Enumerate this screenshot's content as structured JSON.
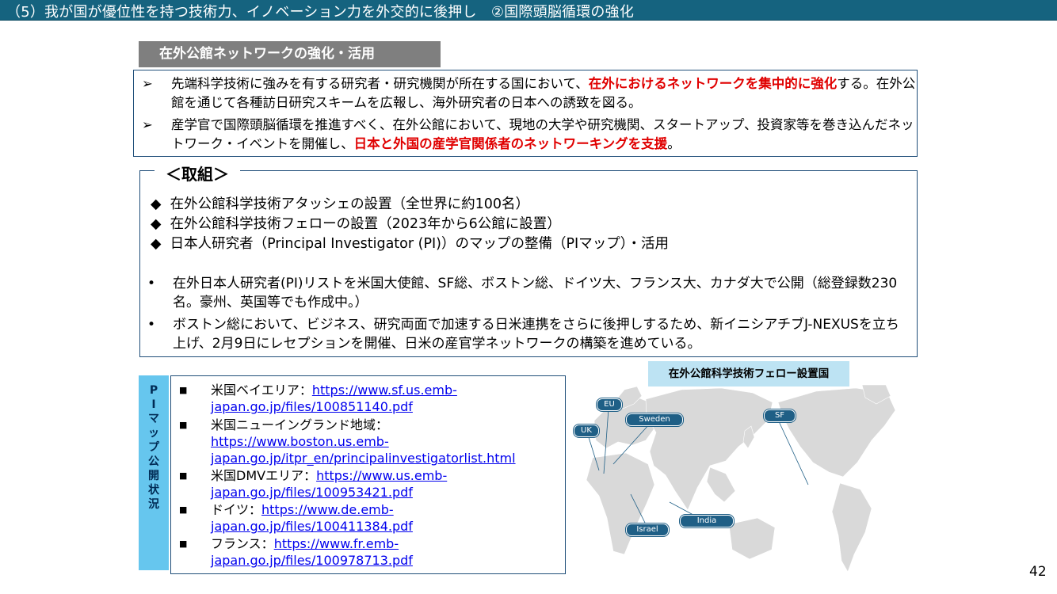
{
  "header": {
    "title": "（5）我が国が優位性を持つ技術力、イノベーション力を外交的に後押し　②国際頭脳循環の強化"
  },
  "section": {
    "label": "在外公館ネットワークの強化・活用"
  },
  "summary": {
    "bullet_mark": "➢",
    "item1_a": "先端科学技術に強みを有する研究者・研究機関が所在する国において、",
    "item1_red": "在外におけるネットワークを集中的に強化",
    "item1_b": "する。在外公館を通じて各種訪日研究スキームを広報し、海外研究者の日本への誘致を図る。",
    "item2_a": "産学官で国際頭脳循環を推進すべく、在外公館において、現地の大学や研究機関、スタートアップ、投資家等を巻き込んだネットワーク・イベントを開催し、",
    "item2_red": "日本と外国の産学官関係者のネットワーキングを支援",
    "item2_b": "。"
  },
  "efforts": {
    "title": "＜取組＞",
    "diamond_mark": "◆",
    "d1": "在外公館科学技術アタッシェの設置（全世界に約100名）",
    "d2": "在外公館科学技術フェローの設置（2023年から6公館に設置）",
    "d3": "日本人研究者（Principal Investigator (PI)）のマップの整備（PIマップ）・活用",
    "dot_mark": "•",
    "p1": "在外日本人研究者(PI)リストを米国大使館、SF総、ボストン総、ドイツ大、フランス大、カナダ大で公開（総登録数230名。豪州、英国等でも作成中。）",
    "p2": "ボストン総において、ビジネス、研究両面で加速する日米連携をさらに後押しするため、新イニシアチブJ-NEXUSを立ち上げ、2月9日にレセプションを開催、日米の産官学ネットワークの構築を進めている。"
  },
  "pi_map": {
    "side_label": [
      "P",
      "I",
      "マ",
      "ッ",
      "プ",
      "公",
      "開",
      "状",
      "況"
    ],
    "square_mark": "■",
    "items": [
      {
        "label": "米国ベイエリア：",
        "url_1": "https://www.sf.us.emb-",
        "url_2": "japan.go.jp/files/100851140.pdf"
      },
      {
        "label": "米国ニューイングランド地域：",
        "url_1": "https://www.boston.us.emb-",
        "url_2": "japan.go.jp/itpr_en/principalinvestigatorlist.html"
      },
      {
        "label": "米国DMVエリア：",
        "url_1": "https://www.us.emb-",
        "url_2": "japan.go.jp/files/100953421.pdf"
      },
      {
        "label": "ドイツ：",
        "url_1": "https://www.de.emb-",
        "url_2": "japan.go.jp/files/100411384.pdf"
      },
      {
        "label": "フランス：",
        "url_1": "https://www.fr.emb-",
        "url_2": "japan.go.jp/files/100978713.pdf"
      }
    ]
  },
  "map": {
    "title": "在外公館科学技術フェロー設置国",
    "pins": {
      "eu": "EU",
      "uk": "UK",
      "sweden": "Sweden",
      "sf": "SF",
      "india": "India",
      "israel": "Israel"
    },
    "land_color": "#d9d9d9",
    "pin_color": "#1f5f86"
  },
  "page_number": "42",
  "colors": {
    "header": "#15637f",
    "accent_red": "#e00000",
    "side_blue": "#66c6ee",
    "border": "#1f4e79"
  }
}
